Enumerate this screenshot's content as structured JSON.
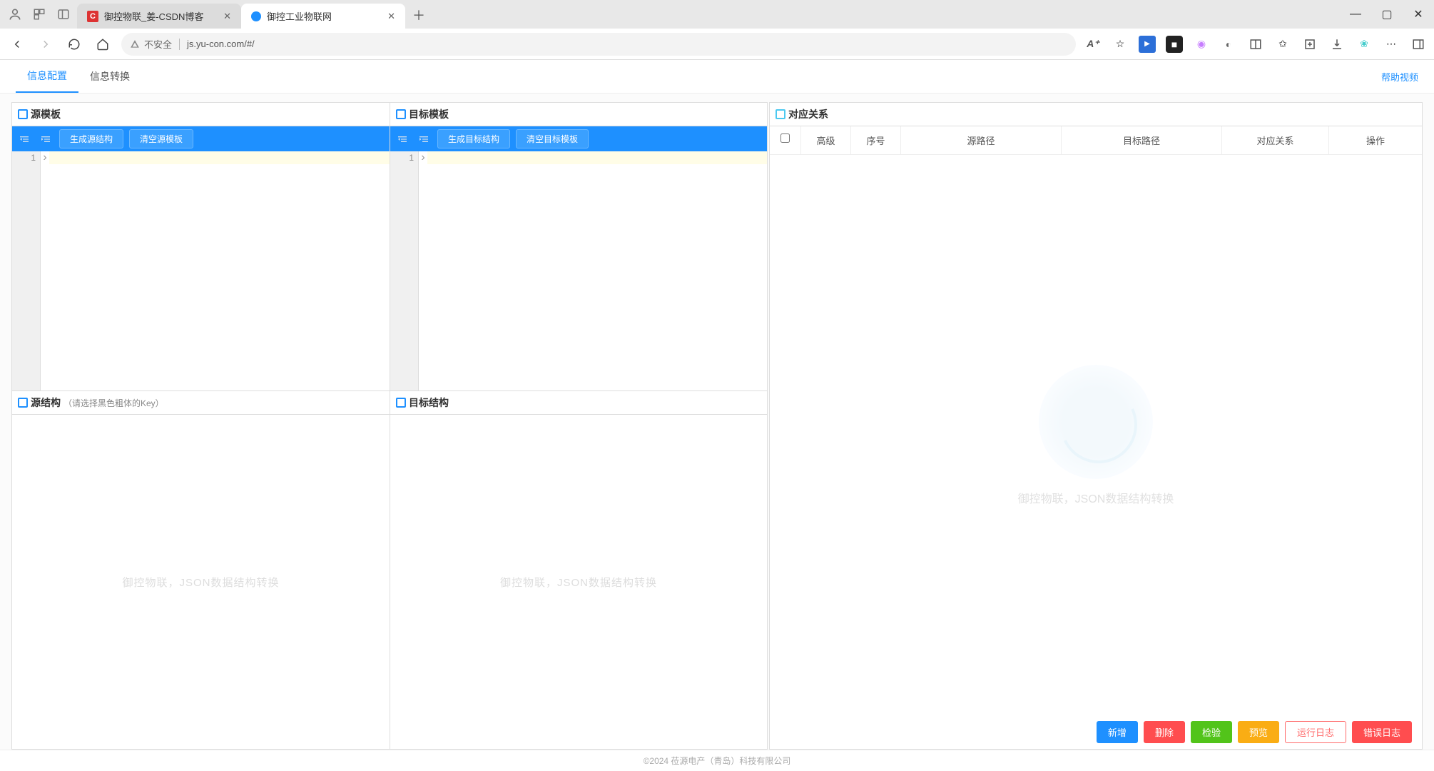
{
  "browser": {
    "tabs": [
      {
        "title": "御控物联_姜-CSDN博客",
        "favicon": "C",
        "favicon_style": "red"
      },
      {
        "title": "御控工业物联网",
        "favicon_style": "blue"
      }
    ],
    "url": "js.yu-con.com/#/",
    "security": "不安全"
  },
  "page": {
    "tabs": {
      "config": "信息配置",
      "convert": "信息转换"
    },
    "help": "帮助视频"
  },
  "panels": {
    "source_template": {
      "title": "源模板",
      "btn_generate": "生成源结构",
      "btn_clear": "清空源模板",
      "line_no": "1"
    },
    "target_template": {
      "title": "目标模板",
      "btn_generate": "生成目标结构",
      "btn_clear": "清空目标模板",
      "line_no": "1"
    },
    "source_struct": {
      "title": "源结构",
      "hint": "（请选择黑色粗体的Key）"
    },
    "target_struct": {
      "title": "目标结构"
    },
    "watermark": "御控物联，JSON数据结构转换"
  },
  "relation": {
    "title": "对应关系",
    "headers": {
      "advanced": "高级",
      "seq": "序号",
      "src_path": "源路径",
      "dst_path": "目标路径",
      "rel": "对应关系",
      "op": "操作"
    },
    "watermark": "御控物联，JSON数据结构转换"
  },
  "actions": {
    "add": "新增",
    "delete": "删除",
    "check": "检验",
    "preview": "预览",
    "runlog": "运行日志",
    "errlog": "错误日志"
  },
  "footer": "©2024 莅源电产（青岛）科技有限公司"
}
